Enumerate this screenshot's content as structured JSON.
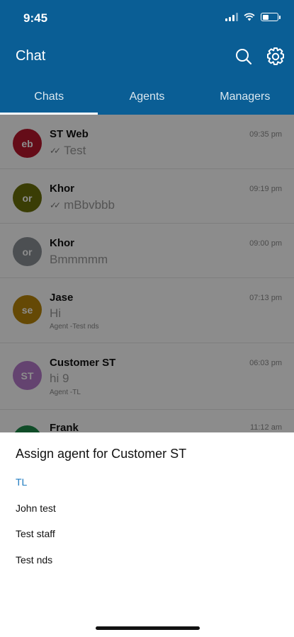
{
  "status": {
    "time": "9:45"
  },
  "header": {
    "title": "Chat",
    "search_icon": "search-icon",
    "settings_icon": "gear-icon"
  },
  "tabs": [
    {
      "label": "Chats",
      "active": true
    },
    {
      "label": "Agents",
      "active": false
    },
    {
      "label": "Managers",
      "active": false
    }
  ],
  "chats": [
    {
      "initials": "eb",
      "name": "ST Web",
      "message": "Test",
      "time": "09:35 pm",
      "read": true,
      "color": "#b8162d",
      "sub": ""
    },
    {
      "initials": "or",
      "name": "Khor",
      "message": "mBbvbbb",
      "time": "09:19 pm",
      "read": true,
      "color": "#6b6f0a",
      "sub": ""
    },
    {
      "initials": "or",
      "name": "Khor",
      "message": "Bmmmmm",
      "time": "09:00 pm",
      "read": false,
      "color": "#8a9096",
      "sub": ""
    },
    {
      "initials": "se",
      "name": "Jase",
      "message": "Hi",
      "time": "07:13 pm",
      "read": false,
      "color": "#b8850a",
      "sub": "Agent -Test nds"
    },
    {
      "initials": "ST",
      "name": "Customer ST",
      "message": "hi 9",
      "time": "06:03 pm",
      "read": false,
      "color": "#b67bcc",
      "sub": "Agent -TL"
    },
    {
      "initials": "",
      "name": "Frank",
      "message": "",
      "time": "11:12 am",
      "read": false,
      "color": "#1e8a4a",
      "sub": ""
    }
  ],
  "sheet": {
    "title": "Assign agent for Customer ST",
    "options": [
      {
        "label": "TL",
        "selected": true
      },
      {
        "label": "John test",
        "selected": false
      },
      {
        "label": "Test staff",
        "selected": false
      },
      {
        "label": "Test nds",
        "selected": false
      }
    ]
  }
}
